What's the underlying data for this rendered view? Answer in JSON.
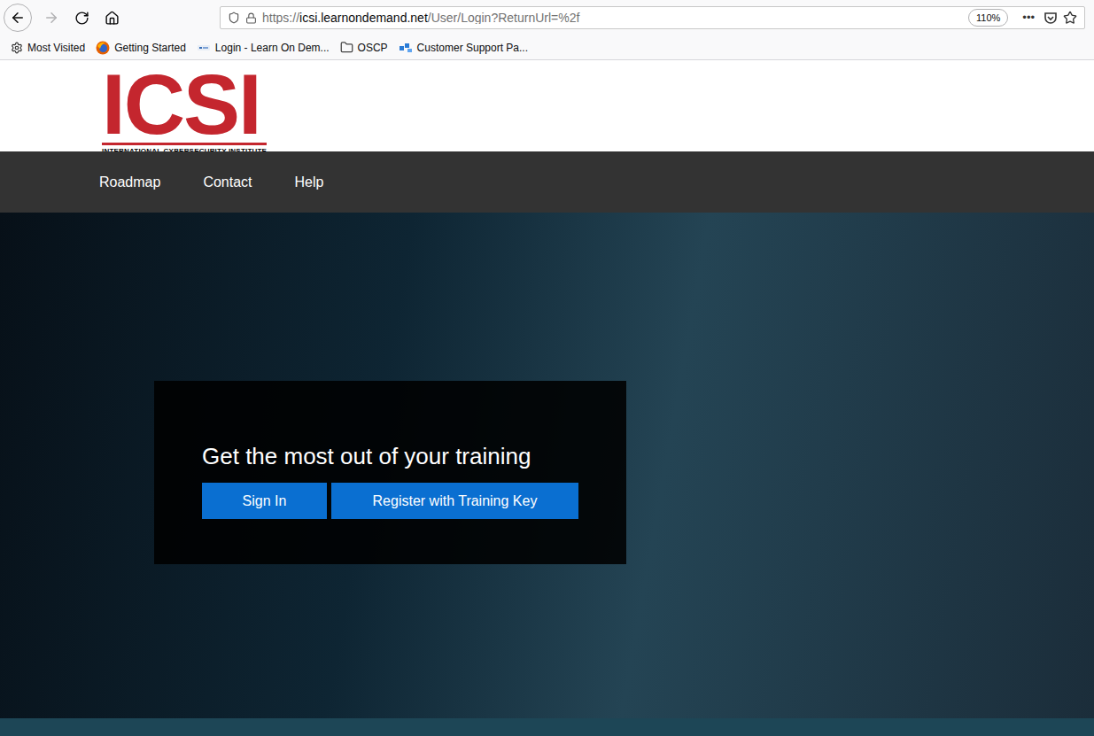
{
  "browser": {
    "nav_buttons": [
      {
        "name": "back",
        "disabled": false
      },
      {
        "name": "forward",
        "disabled": true
      },
      {
        "name": "reload",
        "disabled": false
      },
      {
        "name": "home",
        "disabled": false
      }
    ],
    "address_bar": {
      "scheme": "https://",
      "host": "icsi.learnondemand.net",
      "path": "/User/Login?ReturnUrl=%2f",
      "zoom": "110%",
      "menu": "•••",
      "bookmarked": false
    },
    "bookmarks": [
      {
        "label": "Most Visited",
        "kind": "gear"
      },
      {
        "label": "Getting Started",
        "kind": "firefox"
      },
      {
        "label": "Login - Learn On Dem...",
        "kind": "site"
      },
      {
        "label": "OSCP",
        "kind": "folder"
      },
      {
        "label": "Customer Support Pa...",
        "kind": "support"
      }
    ]
  },
  "logo": {
    "letters": "ICSI",
    "tagline": "INTERNATIONAL CYBERSECURITY INSTITUTE"
  },
  "nav": [
    {
      "label": "Roadmap"
    },
    {
      "label": "Contact"
    },
    {
      "label": "Help"
    }
  ],
  "hero": {
    "heading": "Get the most out of your training",
    "buttons": [
      {
        "label": "Sign In"
      },
      {
        "label": "Register with Training Key"
      }
    ]
  }
}
